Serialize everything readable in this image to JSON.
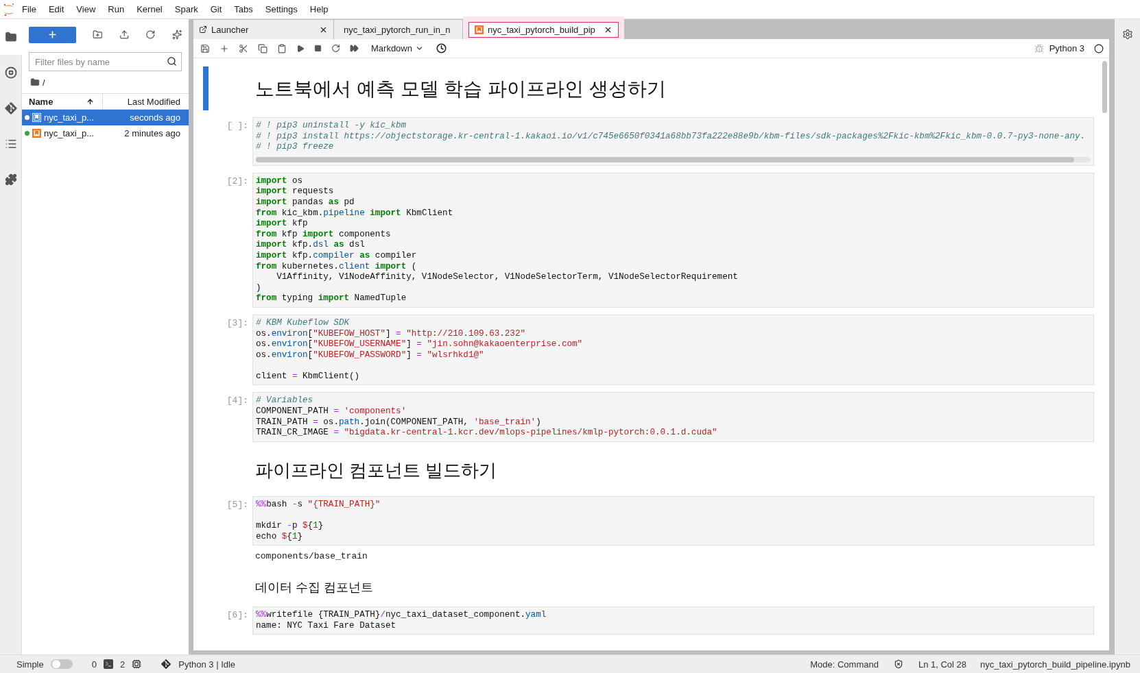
{
  "menu": [
    "File",
    "Edit",
    "View",
    "Run",
    "Kernel",
    "Spark",
    "Git",
    "Tabs",
    "Settings",
    "Help"
  ],
  "file_browser": {
    "filter_placeholder": "Filter files by name",
    "path": "/",
    "columns": [
      "Name",
      "Last Modified"
    ],
    "files": [
      {
        "name": "nyc_taxi_p...",
        "modified": "seconds ago",
        "selected": true,
        "running": true
      },
      {
        "name": "nyc_taxi_p...",
        "modified": "2 minutes ago",
        "selected": false,
        "running": true
      }
    ]
  },
  "tabs": [
    {
      "kind": "launcher",
      "label": "Launcher",
      "selected": false
    },
    {
      "kind": "notebook",
      "label": "nyc_taxi_pytorch_run_in_n",
      "selected": false
    },
    {
      "kind": "notebook",
      "label": "nyc_taxi_pytorch_build_pip",
      "selected": true
    }
  ],
  "toolbar": {
    "cell_type": "Markdown",
    "kernel": "Python 3"
  },
  "cells": [
    {
      "kind": "h1",
      "text": "노트북에서 예측 모델 학습 파이프라인 생성하기",
      "active": true
    },
    {
      "kind": "code",
      "prompt": "[ ]:",
      "active": false,
      "h_scroll": true,
      "lines": [
        {
          "tokens": [
            {
              "kind": "comment",
              "text": "# ! pip3 uninstall -y kic_kbm"
            }
          ]
        },
        {
          "tokens": [
            {
              "kind": "comment",
              "text": "# ! pip3 install https://objectstorage.kr-central-1.kakaoi.io/v1/c745e6650f0341a68bb73fa222e88e9b/kbm-files/sdk-packages%2Fkic-kbm%2Fkic_kbm-0.0.7-py3-none-any."
            }
          ]
        },
        {
          "tokens": [
            {
              "kind": "comment",
              "text": "# ! pip3 freeze"
            }
          ]
        }
      ]
    },
    {
      "kind": "code",
      "prompt": "[2]:",
      "active": false,
      "lines": [
        {
          "tokens": [
            {
              "kind": "keyword",
              "text": "import"
            },
            {
              "kind": "plain",
              "text": " os"
            }
          ]
        },
        {
          "tokens": [
            {
              "kind": "keyword",
              "text": "import"
            },
            {
              "kind": "plain",
              "text": " requests"
            }
          ]
        },
        {
          "tokens": [
            {
              "kind": "keyword",
              "text": "import"
            },
            {
              "kind": "plain",
              "text": " pandas "
            },
            {
              "kind": "keyword",
              "text": "as"
            },
            {
              "kind": "plain",
              "text": " pd"
            }
          ]
        },
        {
          "tokens": [
            {
              "kind": "keyword",
              "text": "from"
            },
            {
              "kind": "plain",
              "text": " kic_kbm."
            },
            {
              "kind": "attr",
              "text": "pipeline "
            },
            {
              "kind": "keyword",
              "text": "import"
            },
            {
              "kind": "plain",
              "text": " KbmClient"
            }
          ]
        },
        {
          "tokens": [
            {
              "kind": "keyword",
              "text": "import"
            },
            {
              "kind": "plain",
              "text": " kfp"
            }
          ]
        },
        {
          "tokens": [
            {
              "kind": "keyword",
              "text": "from"
            },
            {
              "kind": "plain",
              "text": " kfp "
            },
            {
              "kind": "keyword",
              "text": "import"
            },
            {
              "kind": "plain",
              "text": " components"
            }
          ]
        },
        {
          "tokens": [
            {
              "kind": "keyword",
              "text": "import"
            },
            {
              "kind": "plain",
              "text": " kfp."
            },
            {
              "kind": "attr",
              "text": "dsl "
            },
            {
              "kind": "keyword",
              "text": "as"
            },
            {
              "kind": "plain",
              "text": " dsl"
            }
          ]
        },
        {
          "tokens": [
            {
              "kind": "keyword",
              "text": "import"
            },
            {
              "kind": "plain",
              "text": " kfp."
            },
            {
              "kind": "attr",
              "text": "compiler "
            },
            {
              "kind": "keyword",
              "text": "as"
            },
            {
              "kind": "plain",
              "text": " compiler"
            }
          ]
        },
        {
          "tokens": [
            {
              "kind": "keyword",
              "text": "from"
            },
            {
              "kind": "plain",
              "text": " kubernetes."
            },
            {
              "kind": "attr",
              "text": "client "
            },
            {
              "kind": "keyword",
              "text": "import"
            },
            {
              "kind": "plain",
              "text": " ("
            }
          ]
        },
        {
          "tokens": [
            {
              "kind": "plain",
              "text": "    V1Affinity, V1NodeAffinity, V1NodeSelector, V1NodeSelectorTerm, V1NodeSelectorRequirement"
            }
          ]
        },
        {
          "tokens": [
            {
              "kind": "plain",
              "text": ")"
            }
          ]
        },
        {
          "tokens": [
            {
              "kind": "keyword",
              "text": "from"
            },
            {
              "kind": "plain",
              "text": " typing "
            },
            {
              "kind": "keyword",
              "text": "import"
            },
            {
              "kind": "plain",
              "text": " NamedTuple"
            }
          ]
        }
      ]
    },
    {
      "kind": "code",
      "prompt": "[3]:",
      "active": false,
      "lines": [
        {
          "tokens": [
            {
              "kind": "comment",
              "text": "# KBM Kubeflow SDK"
            }
          ]
        },
        {
          "tokens": [
            {
              "kind": "plain",
              "text": "os."
            },
            {
              "kind": "attr",
              "text": "environ"
            },
            {
              "kind": "plain",
              "text": "["
            },
            {
              "kind": "string",
              "text": "\"KUBEFOW_HOST\""
            },
            {
              "kind": "plain",
              "text": "] "
            },
            {
              "kind": "operator",
              "text": "= "
            },
            {
              "kind": "string",
              "text": "\"http://210.109.63.232\""
            }
          ]
        },
        {
          "tokens": [
            {
              "kind": "plain",
              "text": "os."
            },
            {
              "kind": "attr",
              "text": "environ"
            },
            {
              "kind": "plain",
              "text": "["
            },
            {
              "kind": "string",
              "text": "\"KUBEFOW_USERNAME\""
            },
            {
              "kind": "plain",
              "text": "] "
            },
            {
              "kind": "operator",
              "text": "= "
            },
            {
              "kind": "string",
              "text": "\"jin.sohn@kakaoenterprise.com\""
            }
          ]
        },
        {
          "tokens": [
            {
              "kind": "plain",
              "text": "os."
            },
            {
              "kind": "attr",
              "text": "environ"
            },
            {
              "kind": "plain",
              "text": "["
            },
            {
              "kind": "string",
              "text": "\"KUBEFOW_PASSWORD\""
            },
            {
              "kind": "plain",
              "text": "] "
            },
            {
              "kind": "operator",
              "text": "= "
            },
            {
              "kind": "string",
              "text": "\"wlsrhkd1@\""
            }
          ]
        },
        {
          "gap": true,
          "tokens": [
            {
              "kind": "plain",
              "text": "client "
            },
            {
              "kind": "operator",
              "text": "="
            },
            {
              "kind": "plain",
              "text": " KbmClient()"
            }
          ]
        }
      ]
    },
    {
      "kind": "code",
      "prompt": "[4]:",
      "active": false,
      "lines": [
        {
          "tokens": [
            {
              "kind": "comment",
              "text": "# Variables"
            }
          ]
        },
        {
          "tokens": [
            {
              "kind": "plain",
              "text": "COMPONENT_PATH "
            },
            {
              "kind": "operator",
              "text": "= "
            },
            {
              "kind": "string",
              "text": "'components'"
            }
          ]
        },
        {
          "tokens": [
            {
              "kind": "plain",
              "text": "TRAIN_PATH "
            },
            {
              "kind": "operator",
              "text": "="
            },
            {
              "kind": "plain",
              "text": " os."
            },
            {
              "kind": "attr",
              "text": "path"
            },
            {
              "kind": "plain",
              "text": ".join(COMPONENT_PATH, "
            },
            {
              "kind": "string",
              "text": "'base_train'"
            },
            {
              "kind": "plain",
              "text": ")"
            }
          ]
        },
        {
          "tokens": [
            {
              "kind": "plain",
              "text": "TRAIN_CR_IMAGE "
            },
            {
              "kind": "operator",
              "text": "= "
            },
            {
              "kind": "string",
              "text": "\"bigdata.kr-central-1.kcr.dev/mlops-pipelines/kmlp-pytorch:0.0.1.d.cuda\""
            }
          ]
        }
      ]
    },
    {
      "kind": "h2",
      "text": "파이프라인 컴포넌트 빌드하기",
      "active": false
    },
    {
      "kind": "code",
      "prompt": "[5]:",
      "active": false,
      "output": "components/base_train",
      "lines": [
        {
          "tokens": [
            {
              "kind": "operator",
              "text": "%%"
            },
            {
              "kind": "plain",
              "text": "bash "
            },
            {
              "kind": "operator",
              "text": "-"
            },
            {
              "kind": "plain",
              "text": "s "
            },
            {
              "kind": "string",
              "text": "\"{TRAIN_PATH}\""
            }
          ]
        },
        {
          "gap": true,
          "tokens": [
            {
              "kind": "plain",
              "text": "mkdir "
            },
            {
              "kind": "operator",
              "text": "-"
            },
            {
              "kind": "plain",
              "text": "p "
            },
            {
              "kind": "string",
              "text": "$"
            },
            {
              "kind": "plain",
              "text": "{"
            },
            {
              "kind": "number",
              "text": "1"
            },
            {
              "kind": "plain",
              "text": "}"
            }
          ]
        },
        {
          "tokens": [
            {
              "kind": "plain",
              "text": "echo "
            },
            {
              "kind": "string",
              "text": "$"
            },
            {
              "kind": "plain",
              "text": "{"
            },
            {
              "kind": "number",
              "text": "1"
            },
            {
              "kind": "plain",
              "text": "}"
            }
          ]
        }
      ]
    },
    {
      "kind": "h3",
      "text": "데이터 수집 컴포넌트",
      "active": false
    },
    {
      "kind": "code",
      "prompt": "[6]:",
      "active": false,
      "lines": [
        {
          "tokens": [
            {
              "kind": "operator",
              "text": "%%"
            },
            {
              "kind": "plain",
              "text": "writefile {TRAIN_PATH}"
            },
            {
              "kind": "operator",
              "text": "/"
            },
            {
              "kind": "plain",
              "text": "nyc_taxi_dataset_component."
            },
            {
              "kind": "attr",
              "text": "yaml"
            }
          ]
        },
        {
          "tokens": [
            {
              "kind": "plain",
              "text": "name: NYC Taxi Fare Dataset"
            }
          ]
        }
      ]
    }
  ],
  "status_bar": {
    "simple_label": "Simple",
    "simple_on": false,
    "terminals": "0",
    "kernels": "2",
    "kernel_status": "Python 3 | Idle",
    "mode": "Mode: Command",
    "position": "Ln 1, Col 28",
    "file": "nyc_taxi_pytorch_build_pipeline.ipynb"
  }
}
